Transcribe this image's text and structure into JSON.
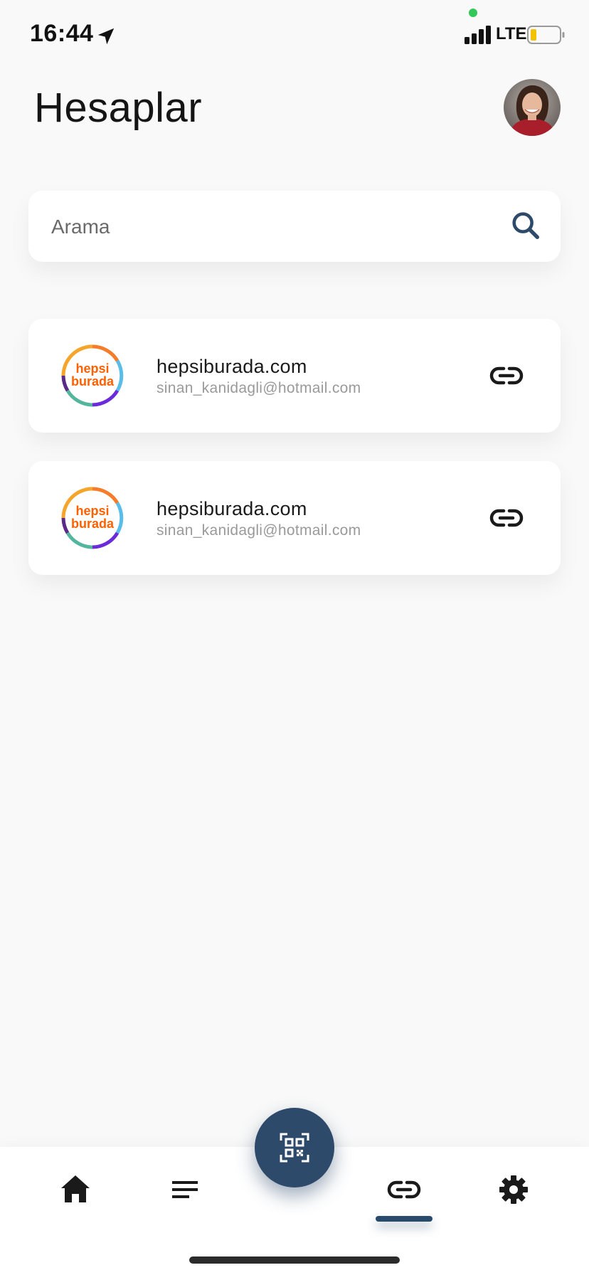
{
  "status_bar": {
    "time": "16:44",
    "network": "LTE",
    "location_icon": "location-arrow-icon",
    "signal_icon": "cellular-signal-icon",
    "battery_icon": "battery-low-icon"
  },
  "header": {
    "title": "Hesaplar",
    "avatar_icon": "profile-avatar"
  },
  "search": {
    "placeholder": "Arama",
    "value": "",
    "icon": "search-icon"
  },
  "accounts": [
    {
      "site": "hepsiburada.com",
      "email": "sinan_kanidagli@hotmail.com",
      "logo_text_line1": "hepsi",
      "logo_text_line2": "burada",
      "action_icon": "link-icon"
    },
    {
      "site": "hepsiburada.com",
      "email": "sinan_kanidagli@hotmail.com",
      "logo_text_line1": "hepsi",
      "logo_text_line2": "burada",
      "action_icon": "link-icon"
    }
  ],
  "bottom_nav": {
    "items": [
      {
        "icon": "home-icon",
        "active": false
      },
      {
        "icon": "list-icon",
        "active": false
      },
      {
        "icon": "link-icon",
        "active": true
      },
      {
        "icon": "gear-icon",
        "active": false
      }
    ],
    "fab_icon": "qr-scan-icon"
  },
  "colors": {
    "background": "#f9f9f9",
    "card": "#ffffff",
    "accent": "#2d4a6b",
    "logo_orange": "#ff6000",
    "text_primary": "#1a1a1a",
    "text_secondary": "#9a9a9a"
  }
}
